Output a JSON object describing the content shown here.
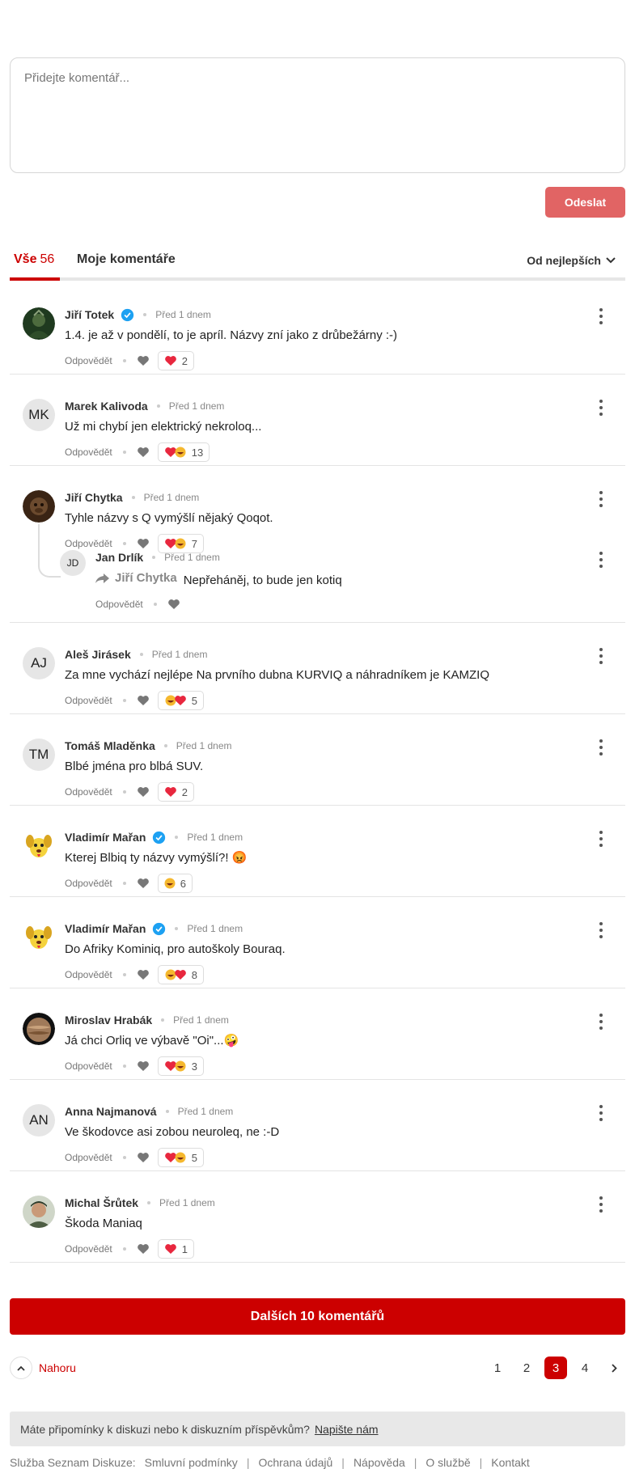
{
  "composer": {
    "placeholder": "Přidejte komentář...",
    "send_label": "Odeslat"
  },
  "tabs": {
    "all_label": "Vše",
    "all_count": "56",
    "mine_label": "Moje komentáře",
    "sort_label": "Od nejlepších"
  },
  "colors": {
    "accent": "#cc0000",
    "send_button": "#e16464",
    "verified": "#1da1f2",
    "heart": "#e8273e"
  },
  "comments": [
    {
      "author": "Jiří Totek",
      "verified": true,
      "time": "Před 1 dnem",
      "text": "1.4. je až v pondělí, to je apríl. Názvy zní jako z drůbežárny :-)",
      "reply_label": "Odpovědět",
      "reaction_count": "2",
      "reaction": "heart-icon",
      "avatar": "photo"
    },
    {
      "author": "Marek Kalivoda",
      "verified": false,
      "time": "Před 1 dnem",
      "text": "Už mi chybí jen elektrický nekroloq...",
      "reply_label": "Odpovědět",
      "reaction_count": "13",
      "reaction": "heart-laugh-icon",
      "initials": "MK"
    },
    {
      "author": "Jiří Chytka",
      "verified": false,
      "time": "Před 1 dnem",
      "text": "Tyhle názvy s Q vymýšlí nějaký Qoqot.",
      "reply_label": "Odpovědět",
      "reaction_count": "7",
      "reaction": "heart-laugh-icon",
      "avatar": "photo",
      "reply": {
        "author": "Jan Drlík",
        "initials": "JD",
        "time": "Před 1 dnem",
        "reply_to": "Jiří Chytka",
        "text": "Nepřeháněj, to bude jen kotiq",
        "reply_label": "Odpovědět"
      }
    },
    {
      "author": "Aleš Jirásek",
      "verified": false,
      "time": "Před 1 dnem",
      "text": "Za mne vychází nejlépe Na prvního dubna KURVIQ a náhradníkem je KAMZIQ",
      "reply_label": "Odpovědět",
      "reaction_count": "5",
      "reaction": "laugh-heart-icon",
      "initials": "AJ"
    },
    {
      "author": "Tomáš Mladěnka",
      "verified": false,
      "time": "Před 1 dnem",
      "text": "Blbé jména pro blbá SUV.",
      "reply_label": "Odpovědět",
      "reaction_count": "2",
      "reaction": "heart-icon",
      "initials": "TM"
    },
    {
      "author": "Vladimír Mařan",
      "verified": true,
      "time": "Před 1 dnem",
      "text": "Kterej Blbiq ty názvy vymýšlí?! 😡",
      "reply_label": "Odpovědět",
      "reaction_count": "6",
      "reaction": "laugh-icon",
      "avatar": "dog"
    },
    {
      "author": "Vladimír Mařan",
      "verified": true,
      "time": "Před 1 dnem",
      "text": "Do Afriky Kominiq, pro autoškoly Bouraq.",
      "reply_label": "Odpovědět",
      "reaction_count": "8",
      "reaction": "laugh-heart-icon",
      "avatar": "dog"
    },
    {
      "author": "Miroslav Hrabák",
      "verified": false,
      "time": "Před 1 dnem",
      "text": "Já chci Orliq ve výbavě \"Oi\"...🤪",
      "reply_label": "Odpovědět",
      "reaction_count": "3",
      "reaction": "heart-laugh-icon",
      "avatar": "planet"
    },
    {
      "author": "Anna Najmanová",
      "verified": false,
      "time": "Před 1 dnem",
      "text": "Ve škodovce asi zobou neuroleq, ne :-D",
      "reply_label": "Odpovědět",
      "reaction_count": "5",
      "reaction": "heart-laugh-icon",
      "initials": "AN"
    },
    {
      "author": "Michal Šrůtek",
      "verified": false,
      "time": "Před 1 dnem",
      "text": "Škoda Maniaq",
      "reply_label": "Odpovědět",
      "reaction_count": "1",
      "reaction": "heart-icon",
      "avatar": "photo"
    }
  ],
  "load_more_label": "Dalších 10 komentářů",
  "to_top_label": "Nahoru",
  "pagination": {
    "pages": [
      "1",
      "2",
      "3",
      "4"
    ],
    "current": "3"
  },
  "feedback": {
    "text": "Máte připomínky k diskuzi nebo k diskuzním příspěvkům?",
    "link": "Napište nám"
  },
  "footer": {
    "prefix": "Služba Seznam Diskuze:",
    "links": [
      "Smluvní podmínky",
      "Ochrana údajů",
      "Nápověda",
      "O službě",
      "Kontakt"
    ]
  }
}
